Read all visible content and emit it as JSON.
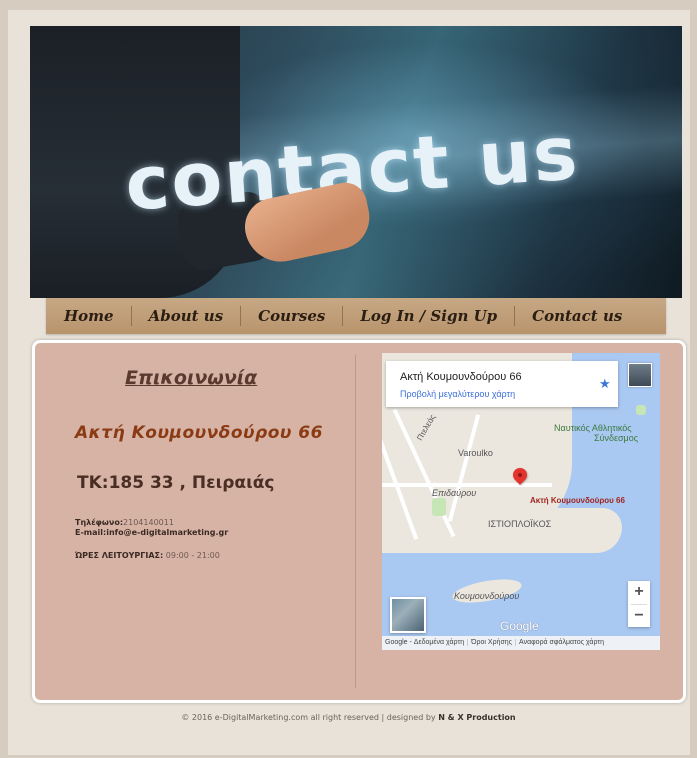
{
  "banner": {
    "title": "contact us"
  },
  "nav": {
    "items": [
      {
        "label": "Home"
      },
      {
        "label": "About us"
      },
      {
        "label": "Courses"
      },
      {
        "label": "Log In / Sign Up"
      },
      {
        "label": "Contact us"
      }
    ]
  },
  "contact": {
    "heading": "Επικοινωνία",
    "address": "Ακτή Κουμουνδούρου 66",
    "postal": "ΤΚ:185 33 , Πειραιάς",
    "phone_label": "Τηλέφωνο:",
    "phone_value": "2104140011",
    "email_label": "E-mail:",
    "email_value": "info@e-digitalmarketing.gr",
    "hours_label": "ΏΡΕΣ ΛΕΙΤΟΥΡΓΙΑΣ:",
    "hours_value": "09:00 - 21:00"
  },
  "map": {
    "card_title": "Ακτή Κουμουνδούρου 66",
    "card_link": "Προβολή μεγαλύτερου χάρτη",
    "pin_label": "Ακτή Κουμουνδούρου 66",
    "labels": {
      "club": "Ναυτικός Αθλητικός",
      "club2": "Σύνδεσμος",
      "varoulko": "Varoulko",
      "epidavrou": "Επιδαύρου",
      "istioploikos": "ΙΣΤΙΟΠΛΟΪΚΟΣ",
      "koumoundourou": "Κουμουνδούρου",
      "pteleas": "Πτελεάς",
      "google": "Google"
    },
    "zoom_in": "+",
    "zoom_out": "−",
    "footer": {
      "data": "Google - Δεδομένα χάρτη",
      "terms": "Όροι Χρήσης",
      "report": "Αναφορά σφάλματος χάρτη"
    }
  },
  "footer": {
    "copyright": "© 2016 e-DigitalMarketing.com all right reserved | designed by ",
    "designer": "N & X Production"
  }
}
